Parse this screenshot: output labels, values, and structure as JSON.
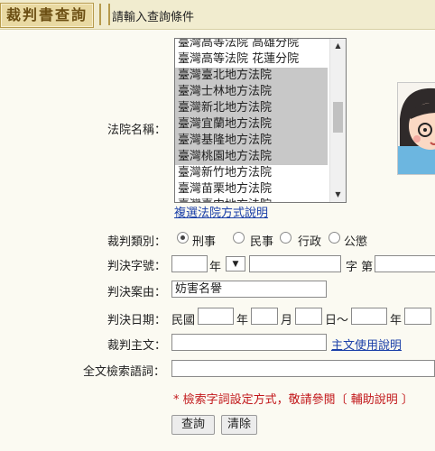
{
  "header": {
    "title": "裁判書查詢",
    "subtitle": "請輸入查詢條件"
  },
  "court": {
    "label": "法院名稱：",
    "options": [
      {
        "label": "臺灣高等法院 高雄分院",
        "selected": false
      },
      {
        "label": "臺灣高等法院 花蓮分院",
        "selected": false
      },
      {
        "label": "臺灣臺北地方法院",
        "selected": true
      },
      {
        "label": "臺灣士林地方法院",
        "selected": true
      },
      {
        "label": "臺灣新北地方法院",
        "selected": true
      },
      {
        "label": "臺灣宜蘭地方法院",
        "selected": true
      },
      {
        "label": "臺灣基隆地方法院",
        "selected": true
      },
      {
        "label": "臺灣桃園地方法院",
        "selected": true
      },
      {
        "label": "臺灣新竹地方法院",
        "selected": false
      },
      {
        "label": "臺灣苗栗地方法院",
        "selected": false
      },
      {
        "label": "臺灣臺中地方法院",
        "selected": false
      }
    ],
    "help_link": "複選法院方式說明"
  },
  "category": {
    "label": "裁判類別：",
    "options": [
      {
        "label": "刑事",
        "checked": true
      },
      {
        "label": "民事",
        "checked": false
      },
      {
        "label": "行政",
        "checked": false
      },
      {
        "label": "公懲",
        "checked": false
      }
    ]
  },
  "case_no": {
    "label": "判決字號：",
    "year_value": "",
    "year_unit": "年",
    "word_value": "",
    "word_unit": "字 第"
  },
  "cause": {
    "label": "判決案由：",
    "value": "妨害名譽"
  },
  "date": {
    "label": "判決日期：",
    "era": "民國",
    "year_unit": "年",
    "month_unit": "月",
    "day_unit": "日～",
    "year_unit2": "年"
  },
  "main_text": {
    "label": "裁判主文：",
    "help_link": "主文使用說明"
  },
  "fulltext": {
    "label": "全文檢索語詞："
  },
  "note": "* 檢索字詞設定方式，敬請參閱〔 輔助說明 〕",
  "buttons": {
    "search": "查詢",
    "clear": "清除"
  },
  "colors": {
    "header_bg": "#f1eccf",
    "header_title": "#6b4e12",
    "link": "#1a3fa8",
    "note": "#c2181b",
    "selected_option": "#c8c8c8"
  }
}
